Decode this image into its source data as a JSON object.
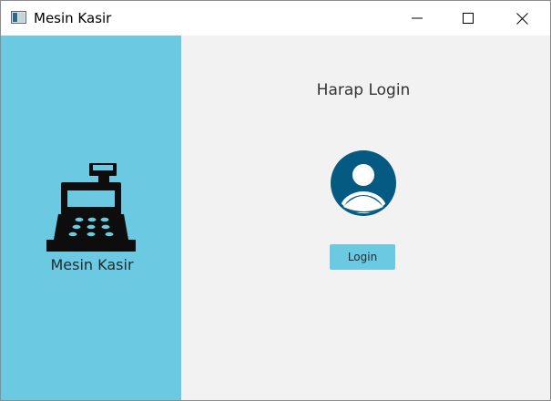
{
  "window": {
    "title": "Mesin Kasir",
    "controls": {
      "minimize_icon": "minimize-icon",
      "maximize_icon": "maximize-icon",
      "close_icon": "close-icon"
    }
  },
  "sidebar": {
    "icon": "cash-register-icon",
    "label": "Mesin Kasir"
  },
  "main": {
    "heading": "Harap Login",
    "avatar_icon": "user-avatar-icon",
    "login_button": "Login"
  },
  "colors": {
    "accent": "#6bcae1",
    "avatar": "#055a82",
    "panel_background": "#f2f2f2"
  }
}
